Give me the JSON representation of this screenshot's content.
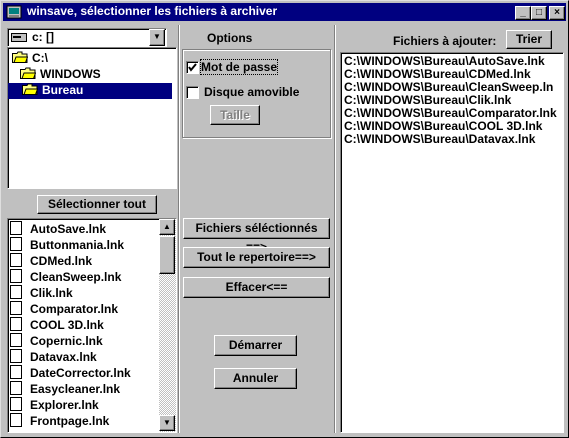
{
  "window": {
    "title": "winsave, sélectionner les fichiers à archiver",
    "minimize": "_",
    "maximize": "□",
    "close": "×"
  },
  "drive": {
    "value": "c: []"
  },
  "tree": {
    "items": [
      {
        "label": "C:\\"
      },
      {
        "label": "WINDOWS"
      },
      {
        "label": "Bureau",
        "selected": true
      }
    ]
  },
  "select_all_label": "Sélectionner tout",
  "files": [
    "AutoSave.lnk",
    "Buttonmania.lnk",
    "CDMed.lnk",
    "CleanSweep.lnk",
    "Clik.lnk",
    "Comparator.lnk",
    "COOL 3D.lnk",
    "Copernic.lnk",
    "Datavax.lnk",
    "DateCorrector.lnk",
    "Easycleaner.lnk",
    "Explorer.lnk",
    "Frontpage.lnk"
  ],
  "options": {
    "title": "Options",
    "password": {
      "label": "Mot de passe",
      "checked": true
    },
    "removable": {
      "label": "Disque amovible",
      "checked": false
    },
    "size_label": "Taille"
  },
  "actions": {
    "selected_files": "Fichiers séléctionnés ==>",
    "whole_dir": "Tout le repertoire==>",
    "clear": "Effacer<==",
    "start": "Démarrer",
    "cancel": "Annuler"
  },
  "right": {
    "header": "Fichiers à ajouter:",
    "sort_label": "Trier",
    "items": [
      "C:\\WINDOWS\\Bureau\\AutoSave.lnk",
      "C:\\WINDOWS\\Bureau\\CDMed.lnk",
      "C:\\WINDOWS\\Bureau\\CleanSweep.ln",
      "C:\\WINDOWS\\Bureau\\Clik.lnk",
      "C:\\WINDOWS\\Bureau\\Comparator.lnk",
      "C:\\WINDOWS\\Bureau\\COOL 3D.lnk",
      "C:\\WINDOWS\\Bureau\\Datavax.lnk"
    ]
  },
  "colors": {
    "titlebar": "#000080",
    "face": "#c0c0c0",
    "selection": "#000080"
  }
}
